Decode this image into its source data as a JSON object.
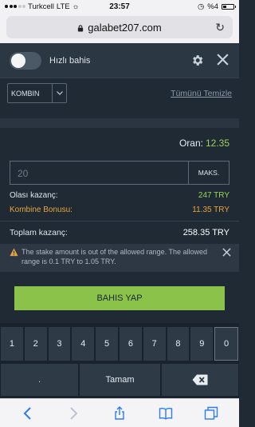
{
  "status": {
    "carrier": "Turkcell",
    "network": "LTE",
    "time": "23:57",
    "battery": "%4"
  },
  "browser": {
    "url": "galabet207.com"
  },
  "quick": {
    "label": "Hızlı bahis"
  },
  "controls": {
    "bet_type": "KOMBIN",
    "clear_all": "Tümünü Temizle"
  },
  "odds": {
    "label": "Oran:",
    "value": "12.35"
  },
  "stake": {
    "value": "20",
    "max_label": "MAKS."
  },
  "summary": {
    "possible_win_label": "Olası kazanç:",
    "possible_win_value": "247 TRY",
    "bonus_label": "Kombine Bonusu:",
    "bonus_value": "11.35 TRY",
    "total_label": "Toplam kazanç:",
    "total_value": "258.35 TRY"
  },
  "alert": {
    "message": "The stake amount is out of the allowed range. The allowed range is 0.1 TRY to 1.05 TRY."
  },
  "bet_button": "BAHIS YAP",
  "keyboard": {
    "digits": [
      "1",
      "2",
      "3",
      "4",
      "5",
      "6",
      "7",
      "8",
      "9",
      "0"
    ],
    "dot": ".",
    "done": "Tamam"
  },
  "colors": {
    "accent_green": "#8bc34a",
    "bonus_orange": "#e7a43a",
    "bg": "#1f2a35"
  }
}
